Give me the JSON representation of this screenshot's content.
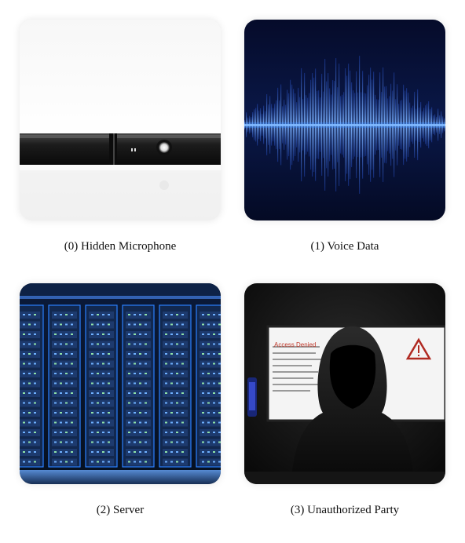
{
  "panels": [
    {
      "caption": "(0) Hidden Microphone",
      "icon": "microphone"
    },
    {
      "caption": "(1) Voice Data",
      "icon": "waveform"
    },
    {
      "caption": "(2) Server",
      "icon": "server-racks"
    },
    {
      "caption": "(3) Unauthorized Party",
      "icon": "hooded-person"
    }
  ],
  "screen_text": {
    "access_denied": "Access Denied"
  },
  "colors": {
    "wave_glow": "#3d8bff",
    "server_blue": "#2a7fff",
    "warning_red": "#c0392b"
  }
}
